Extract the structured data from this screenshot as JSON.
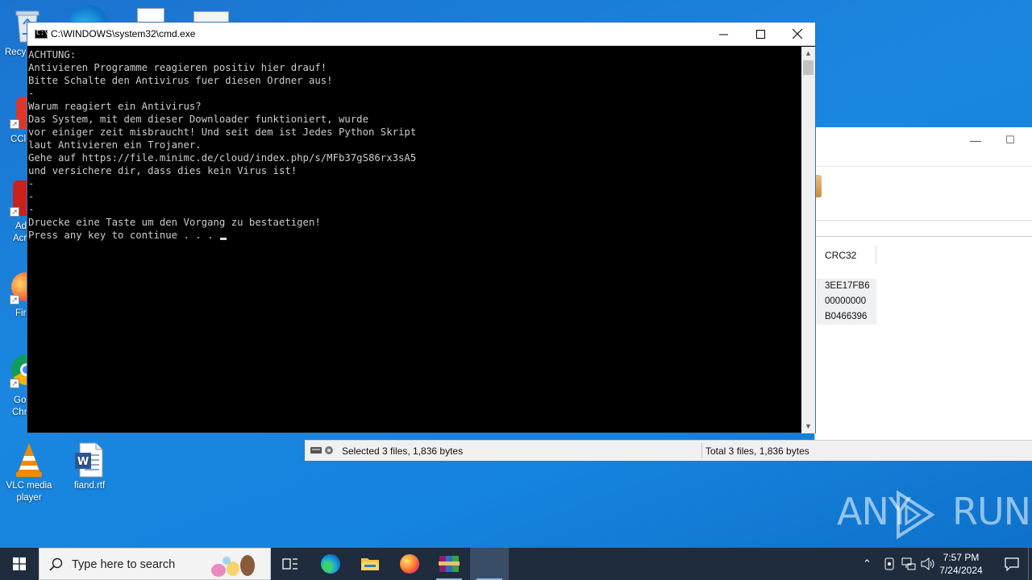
{
  "desktop": {
    "icons": [
      {
        "label": "Recycle Bin",
        "visible_label": "Recy"
      },
      {
        "label": "CCl",
        "visible_label": "CCl"
      },
      {
        "label": "Adobe Acrobat",
        "visible_label_1": "Ad",
        "visible_label_2": "Acr"
      },
      {
        "label": "Firefox",
        "visible_label": "Fir"
      },
      {
        "label": "Google Chrome",
        "visible_label_1": "Go",
        "visible_label_2": "Chr"
      }
    ],
    "vlc": {
      "label": "VLC media player"
    },
    "doc": {
      "label": "fiand.rtf"
    }
  },
  "cmd_window": {
    "title": "C:\\WINDOWS\\system32\\cmd.exe",
    "lines": [
      "ACHTUNG:",
      "Antivieren Programme reagieren positiv hier drauf!",
      "Bitte Schalte den Antivirus fuer diesen Ordner aus!",
      "-",
      "Warum reagiert ein Antivirus?",
      "Das System, mit dem dieser Downloader funktioniert, wurde",
      "vor einiger zeit misbraucht! Und seit dem ist Jedes Python Skript",
      "laut Antivieren ein Trojaner.",
      "Gehe auf https://file.minimc.de/cloud/index.php/s/MFb37gS86rx3sA5",
      "und versichere dir, dass dies kein Virus ist!",
      "-",
      "-",
      "-",
      "Druecke eine Taste um den Vorgang zu bestaetigen!",
      "Press any key to continue . . . "
    ]
  },
  "archive_window": {
    "column_header": "CRC32",
    "crc_values": [
      "3EE17FB6",
      "00000000",
      "B0466396"
    ],
    "status_selected": "Selected 3 files, 1,836 bytes",
    "status_total": "Total 3 files, 1,836 bytes"
  },
  "watermark": {
    "text_left": "ANY",
    "text_right": "RUN"
  },
  "taskbar": {
    "search_placeholder": "Type here to search",
    "time": "7:57 PM",
    "date": "7/24/2024"
  },
  "colors": {
    "console_bg": "#000000",
    "console_text": "#cccccc",
    "taskbar": "#1f2c3d",
    "desktop": "#1a86df"
  }
}
